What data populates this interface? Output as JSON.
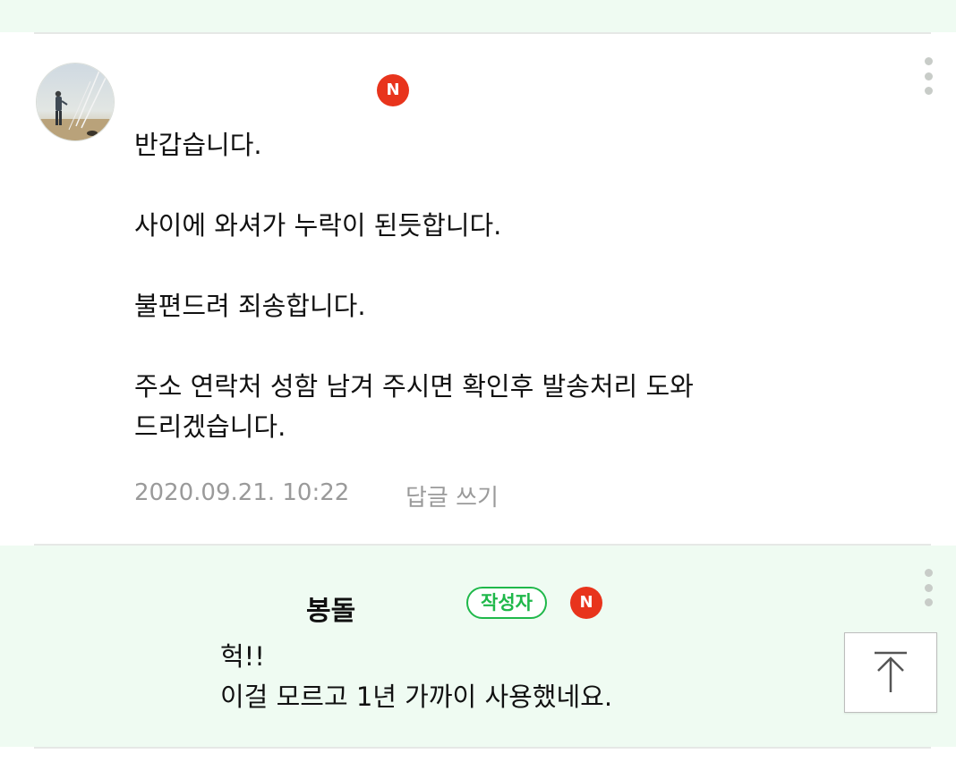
{
  "comments": [
    {
      "nickname": "",
      "new_badge": "N",
      "text": "반갑습니다.\n\n사이에 와셔가 누락이 된듯합니다.\n\n불편드려 죄송합니다.\n\n주소 연락처 성함 남겨 주시면 확인후 발송처리 도와\n드리겠습니다.",
      "timestamp": "2020.09.21. 10:22",
      "reply_label": "답글 쓰기",
      "avatar_icon": "fisherman-avatar-photo"
    },
    {
      "nickname": "봉돌",
      "author_badge": "작성자",
      "new_badge": "N",
      "text": "헉!!\n이걸 모르고 1년 가까이 사용했네요.",
      "is_reply": true
    }
  ],
  "icons": {
    "more": "more-vertical-icon",
    "scroll_top": "arrow-up-icon"
  },
  "colors": {
    "reply_background": "#effbf2",
    "new_badge": "#e8341c",
    "author_badge": "#1fb84a",
    "meta_text": "#9a9a9a"
  }
}
